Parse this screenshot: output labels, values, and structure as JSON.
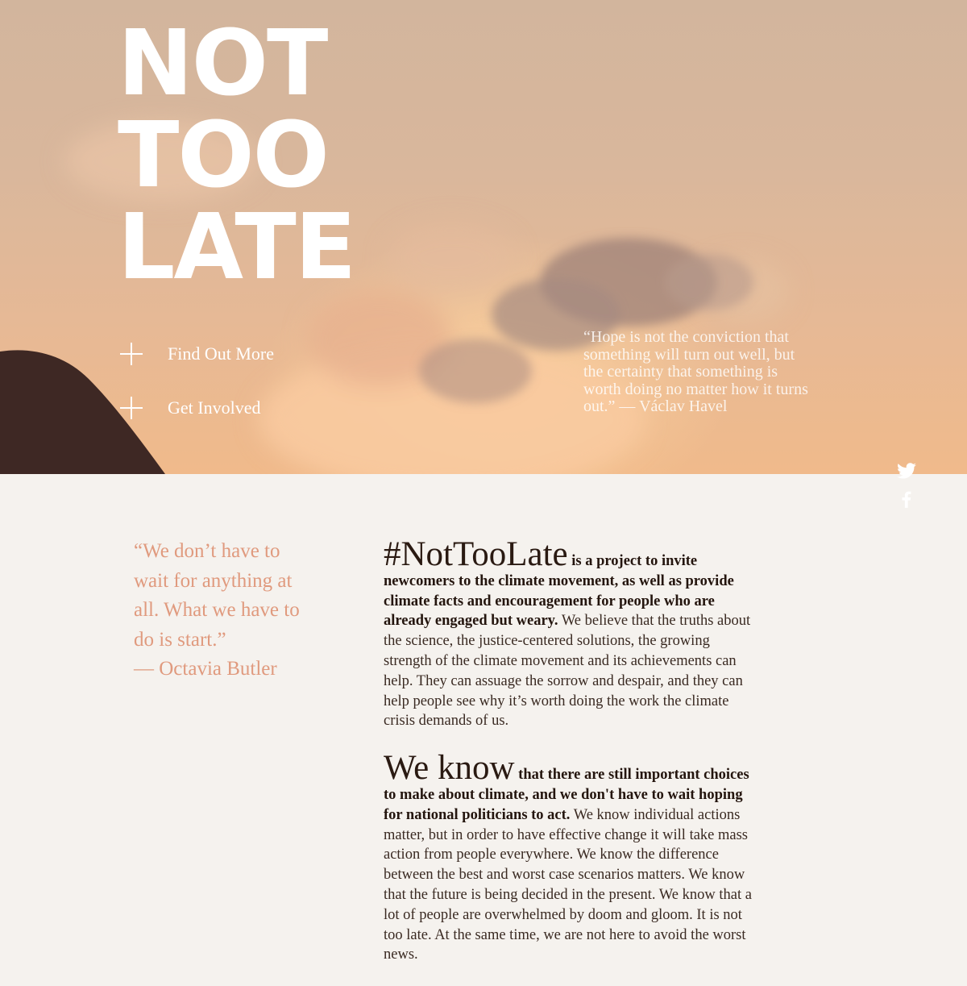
{
  "hero": {
    "title_lines": [
      "NOT",
      "TOO",
      "LATE"
    ],
    "links": [
      {
        "label": "Find Out More",
        "icon": "plus-icon"
      },
      {
        "label": "Get Involved",
        "icon": "plus-icon"
      }
    ],
    "quote": "“Hope is not the conviction that something will turn out well, but the certainty that something is worth doing no matter how it turns out.” — Václav Havel"
  },
  "social": {
    "icons": [
      "twitter-icon",
      "facebook-icon"
    ]
  },
  "side_quote": {
    "text": "“We don’t have to wait for anything at all. What we have to do is start.”",
    "attribution": "— Octavia Butler"
  },
  "body": {
    "paragraph1": {
      "lead": "#NotTooLate",
      "strong": " is a project to invite newcomers to the climate movement, as well as provide climate facts and encouragement for people who are already engaged but weary.",
      "rest": " We believe that the truths about the science, the justice-centered solutions, the growing strength of the climate movement and its achievements can help. They can assuage the sorrow and despair, and they can help people see why it’s worth doing the work the climate crisis demands of us."
    },
    "paragraph2": {
      "lead": "We know",
      "strong": " that there are still important choices to make about climate, and we don't have to wait hoping for national politicians to act.",
      "rest": " We know individual actions matter, but in order to have effective change it will take mass action from people everywhere. We know the difference between the best and worst case scenarios matters. We know that the future is being decided in the present. We know that a lot of people are overwhelmed by doom and gloom. It is not too late. At the same time, we are not here to avoid the worst news."
    }
  },
  "colors": {
    "background": "#f5f2ee",
    "quote_accent": "#e09a7e",
    "body_text": "#3a2a22",
    "hero_text": "#ffffff"
  }
}
